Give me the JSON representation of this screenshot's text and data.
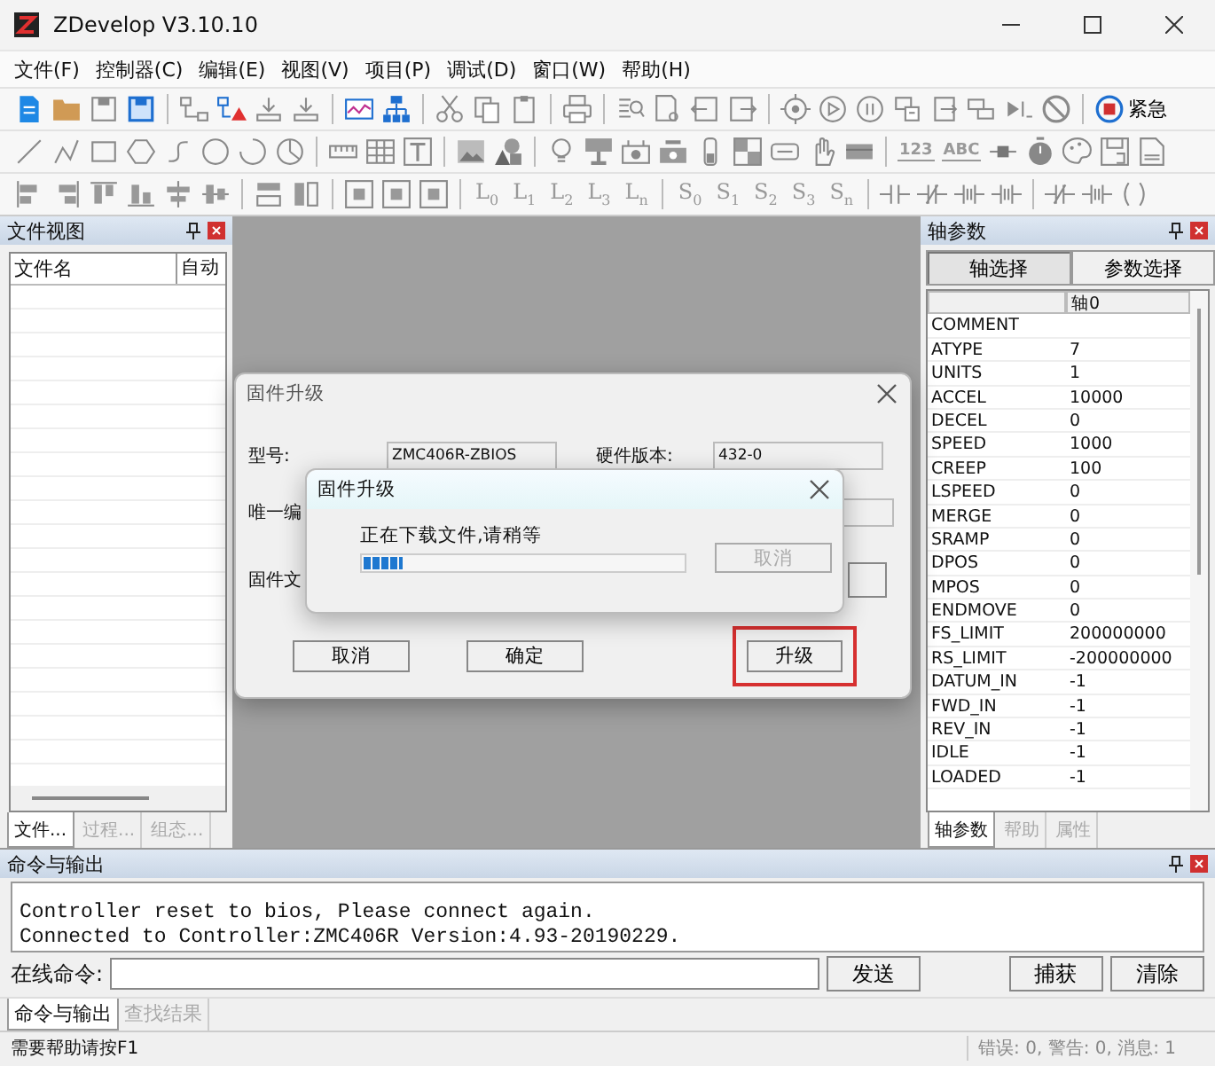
{
  "window": {
    "title": "ZDevelop V3.10.10"
  },
  "menu": [
    "文件(F)",
    "控制器(C)",
    "编辑(E)",
    "视图(V)",
    "项目(P)",
    "调试(D)",
    "窗口(W)",
    "帮助(H)"
  ],
  "toolbar": {
    "emergency_label": "紧急",
    "text_tools": [
      "123",
      "ABC"
    ],
    "l_tools": [
      "L$_{0}$",
      "L$_{1}$",
      "L$_{2}$",
      "L$_{3}$",
      "L$_{n}$"
    ],
    "s_tools": [
      "S$_{0}$",
      "S$_{1}$",
      "S$_{2}$",
      "S$_{3}$",
      "S$_{n}$"
    ]
  },
  "file_view": {
    "title": "文件视图",
    "columns": [
      "文件名",
      "自动"
    ],
    "tabs": [
      {
        "label": "文件...",
        "selected": true
      },
      {
        "label": "过程...",
        "selected": false
      },
      {
        "label": "组态...",
        "selected": false
      }
    ]
  },
  "axis_params": {
    "title": "轴参数",
    "buttons": [
      {
        "label": "轴选择",
        "selected": true
      },
      {
        "label": "参数选择",
        "selected": false
      }
    ],
    "column": "轴0",
    "rows": [
      {
        "name": "COMMENT"
      },
      {
        "name": "ATYPE",
        "value": "7"
      },
      {
        "name": "UNITS",
        "value": "1"
      },
      {
        "name": "ACCEL",
        "value": "10000"
      },
      {
        "name": "DECEL",
        "value": "0"
      },
      {
        "name": "SPEED",
        "value": "1000"
      },
      {
        "name": "CREEP",
        "value": "100"
      },
      {
        "name": "LSPEED",
        "value": "0"
      },
      {
        "name": "MERGE",
        "value": "0"
      },
      {
        "name": "SRAMP",
        "value": "0"
      },
      {
        "name": "DPOS",
        "value": "0"
      },
      {
        "name": "MPOS",
        "value": "0"
      },
      {
        "name": "ENDMOVE",
        "value": "0"
      },
      {
        "name": "FS_LIMIT",
        "value": "200000000"
      },
      {
        "name": "RS_LIMIT",
        "value": "-200000000"
      },
      {
        "name": "DATUM_IN",
        "value": "-1"
      },
      {
        "name": "FWD_IN",
        "value": "-1"
      },
      {
        "name": "REV_IN",
        "value": "-1"
      },
      {
        "name": "IDLE",
        "value": "-1"
      },
      {
        "name": "LOADED",
        "value": "-1"
      }
    ],
    "tabs": [
      {
        "label": "轴参数",
        "selected": true
      },
      {
        "label": "帮助",
        "selected": false
      },
      {
        "label": "属性",
        "selected": false
      }
    ]
  },
  "firmware_dialog": {
    "title": "固件升级",
    "fields": [
      {
        "label": "型号:",
        "value": "ZMC406R-ZBIOS"
      },
      {
        "label": "硬件版本:",
        "value": "432-0"
      },
      {
        "label": "唯一编"
      },
      {
        "label": "固件文"
      }
    ],
    "buttons": [
      {
        "label": "取消",
        "highlighted": false
      },
      {
        "label": "确定",
        "highlighted": false
      },
      {
        "label": "升级",
        "highlighted": true
      }
    ]
  },
  "progress_dialog": {
    "title": "固件升级",
    "message": "正在下载文件,请稍等",
    "level": 0.12,
    "cancel": {
      "label": "取消",
      "disabled": true
    }
  },
  "output": {
    "title": "命令与输出",
    "lines": [
      "Controller reset to bios, Please connect again.",
      "Connected to Controller:ZMC406R Version:4.93-20190229."
    ],
    "command_label": "在线命令:",
    "buttons": [
      "发送",
      "捕获",
      "清除"
    ],
    "tabs": [
      {
        "label": "命令与输出",
        "selected": true
      },
      {
        "label": "查找结果",
        "selected": false
      }
    ]
  },
  "status_bar": {
    "help": "需要帮助请按F1",
    "counts": "错误: 0, 警告: 0, 消息: 1"
  }
}
